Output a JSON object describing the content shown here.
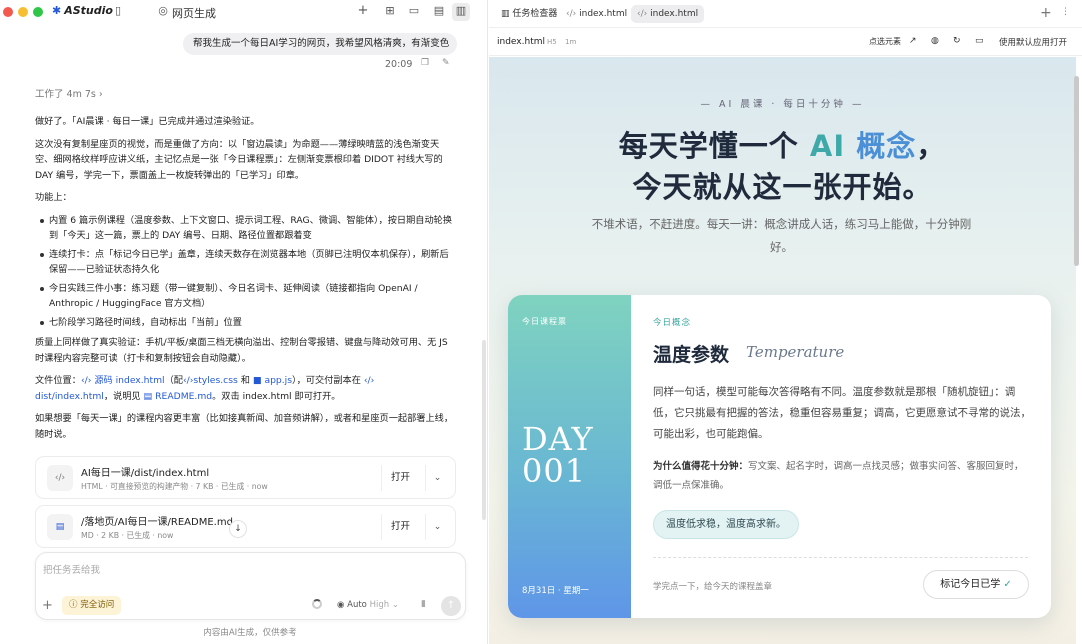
{
  "app": {
    "name": "AStudio",
    "window_title": "网页生成",
    "traffic_colors": [
      "#f25a50",
      "#f6be30",
      "#2fc64a"
    ],
    "accent": "#2459d6"
  },
  "chat": {
    "user_message": "帮我生成一个每日AI学习的网页，我希望风格清爽，有渐变色",
    "time": "20:09",
    "worked": "工作了 4m 7s",
    "paragraphs": {
      "p1": "做好了。「AI晨课 · 每日一课」已完成并通过渲染验证。",
      "p2": "这次没有复制星座页的视觉，而是重做了方向：以「窗边晨读」为命题——薄绿映晴蓝的浅色渐变天空、细网格纹样呼应讲义纸，主记忆点是一张「今日课程票」：左侧渐变票根印着 DIDOT 衬线大写的 DAY 编号，学完一下，票面盖上一枚旋转弹出的「已学习」印章。",
      "p3": "功能上：",
      "p4": "质量上同样做了真实验证：手机/平板/桌面三档无横向溢出、控制台零报错、键盘与降动效可用、无 JS 时课程内容完整可读（打卡和复制按钮会自动隐藏）。",
      "p6": "如果想要「每天一课」的课程内容更丰富（比如接真新闻、加音频讲解），或者和星座页一起部署上线，随时说。"
    },
    "features": [
      "内置 6 篇示例课程（温度参数、上下文窗口、提示词工程、RAG、微调、智能体），按日期自动轮换到「今天」这一篇，票上的 DAY 编号、日期、路径位置都跟着变",
      "连续打卡：点「标记今日已学」盖章，连续天数存在浏览器本地（页脚已注明仅本机保存），刷新后保留——已验证状态持久化",
      "今日实践三件小事：练习题（带一键复制）、今日名词卡、延伸阅读（链接都指向 OpenAI / Anthropic / HuggingFace 官方文档）",
      "七阶段学习路径时间线，自动标出「当前」位置"
    ],
    "file_location": {
      "prefix": "文件位置：",
      "src_label": "源码",
      "index": "index.html",
      "with": "（配",
      "styles": "styles.css",
      "and": "和",
      "appjs": "app.js",
      "deliver": "），可交付副本在",
      "dist": "dist/index.html",
      "explain": "，说明见",
      "readme": "README.md",
      "tail": "。双击 index.html 即可打开。"
    },
    "attachments": [
      {
        "title": "AI每日一课/dist/index.html",
        "sub": "HTML · 可直接预览的构建产物 · 7 KB · 已生成 · now",
        "open": "打开",
        "icon": "code-file-icon"
      },
      {
        "title": "/落地页/AI每日一课/README.md",
        "sub": "MD · 2 KB · 已生成 · now",
        "open": "打开",
        "icon": "document-icon"
      }
    ]
  },
  "composer": {
    "placeholder": "把任务丢给我",
    "access": "完全访问",
    "model": "Auto",
    "level": "High"
  },
  "disclaimer": "内容由AI生成，仅供参考",
  "right": {
    "tabs": [
      "任务检查器",
      "index.html",
      "index.html"
    ],
    "file_name": "index.html",
    "file_badge": "H5",
    "file_time": "1m",
    "pick_element": "点选元素",
    "open_default": "使用默认应用打开"
  },
  "preview": {
    "kicker": "— AI 晨课 · 每日十分钟 —",
    "h1_line1_a": "每天学懂一个",
    "h1_ai": "AI",
    "h1_concept": "概念",
    "h1_line1_end": "，",
    "h1_line2": "今天就从这一张开始。",
    "lead": "不堆术语，不赶进度。每天一讲：概念讲成人话，练习马上能做，十分钟刚好。",
    "ticket": {
      "stub_label": "今日课程票",
      "day_word": "DAY",
      "day_num": "001",
      "date": "8月31日 · 星期一",
      "label": "今日概念",
      "title": "温度参数",
      "title_en": "Temperature",
      "desc": "同样一句话，模型可能每次答得略有不同。温度参数就是那根「随机旋钮」：调低，它只挑最有把握的答法，稳重但容易重复；调高，它更愿意试不寻常的说法，可能出彩，也可能跑偏。",
      "why_label": "为什么值得花十分钟：",
      "why_text": "写文案、起名字时，调高一点找灵感；做事实问答、客服回复时，调低一点保准确。",
      "chip": "温度低求稳，温度高求新。",
      "footer": "学完点一下，给今天的课程盖章",
      "mark_button": "标记今日已学",
      "check": "✓"
    }
  }
}
